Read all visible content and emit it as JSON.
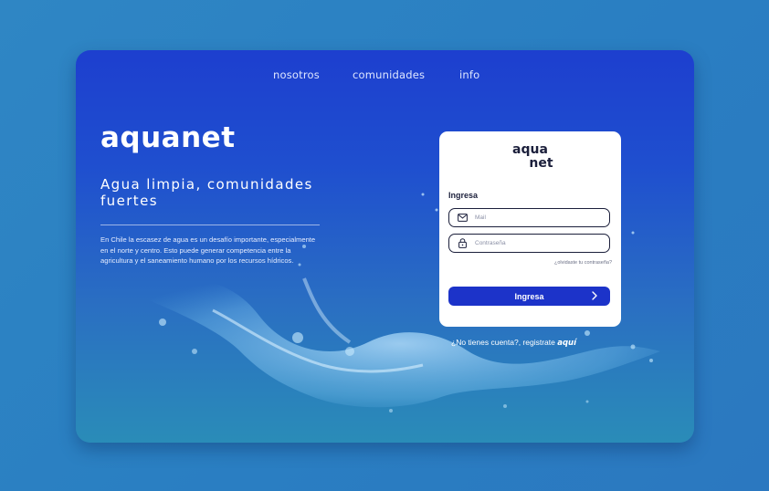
{
  "nav": {
    "items": [
      {
        "label": "nosotros"
      },
      {
        "label": "comunidades"
      },
      {
        "label": "info"
      }
    ]
  },
  "hero": {
    "brand": "aquanet",
    "tagline": "Agua limpia, comunidades fuertes",
    "description": "En Chile la escasez de agua es un desafío importante, especialmente en el norte y centro. Esto puede generar competencia entre la agricultura y el saneamiento humano por los recursos hídricos."
  },
  "login": {
    "logo_line1": "aqua",
    "logo_line2": "net",
    "title": "Ingresa",
    "mail_placeholder": "Mail",
    "mail_value": "",
    "password_placeholder": "Contraseña",
    "password_value": "",
    "forgot": "¿olvidaste tu contraseña?",
    "submit": "Ingresa",
    "register_text": "¿No tienes cuenta?, registrate ",
    "register_link": "aquí"
  },
  "colors": {
    "page_bg": "#2f86c4",
    "frame_top": "#1d3fcf",
    "frame_bottom": "#2a8cb8",
    "button": "#1c33c9",
    "card": "#ffffff",
    "text_dark": "#1b1f3b"
  },
  "icons": [
    "mail-icon",
    "lock-icon",
    "chevron-right-icon",
    "water-splash-image"
  ]
}
